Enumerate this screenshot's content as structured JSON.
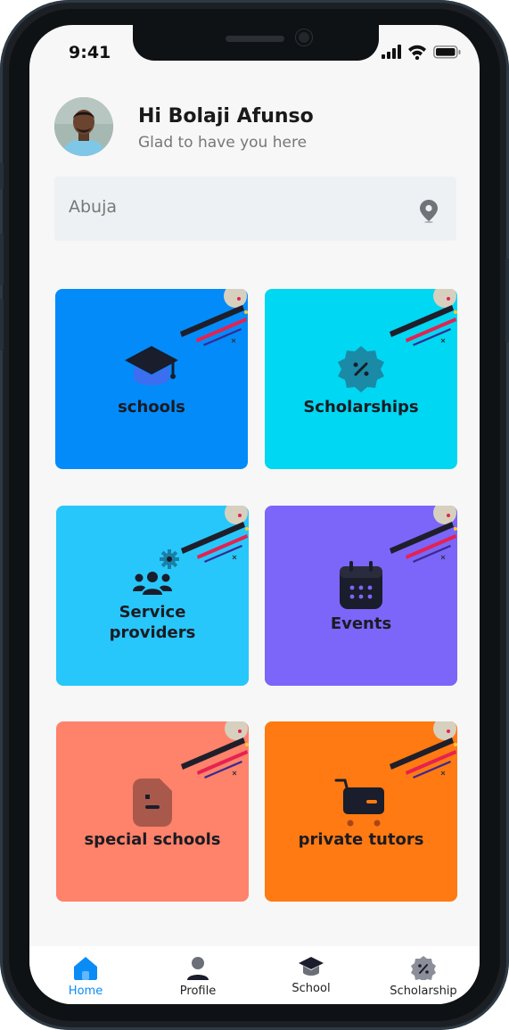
{
  "status_bar": {
    "time": "9:41"
  },
  "header": {
    "greeting": "Hi Bolaji Afunso",
    "subtitle": "Glad to have you here"
  },
  "search": {
    "value": "Abuja",
    "icon": "location-pin-icon"
  },
  "cards": [
    {
      "label": "schools",
      "icon": "graduation-cap-icon",
      "color": "#038bfa"
    },
    {
      "label": "Scholarships",
      "icon": "discount-badge-icon",
      "color": "#00d7f2"
    },
    {
      "label_line1": "Service",
      "label_line2": "providers",
      "icon": "service-providers-icon",
      "color": "#27c7fb"
    },
    {
      "label": "Events",
      "icon": "calendar-icon",
      "color": "#7b66f9"
    },
    {
      "label": "special schools",
      "icon": "document-icon",
      "color": "#ff826a"
    },
    {
      "label": "private tutors",
      "icon": "shopping-cart-icon",
      "color": "#ff7a12"
    }
  ],
  "bottom_nav": [
    {
      "label": "Home",
      "icon": "home-icon",
      "active": true,
      "color": "#0a8cf7"
    },
    {
      "label": "Profile",
      "icon": "profile-icon",
      "active": false
    },
    {
      "label": "School",
      "icon": "graduation-cap-icon",
      "active": false
    },
    {
      "label": "Scholarship",
      "icon": "discount-badge-icon",
      "active": false
    }
  ]
}
